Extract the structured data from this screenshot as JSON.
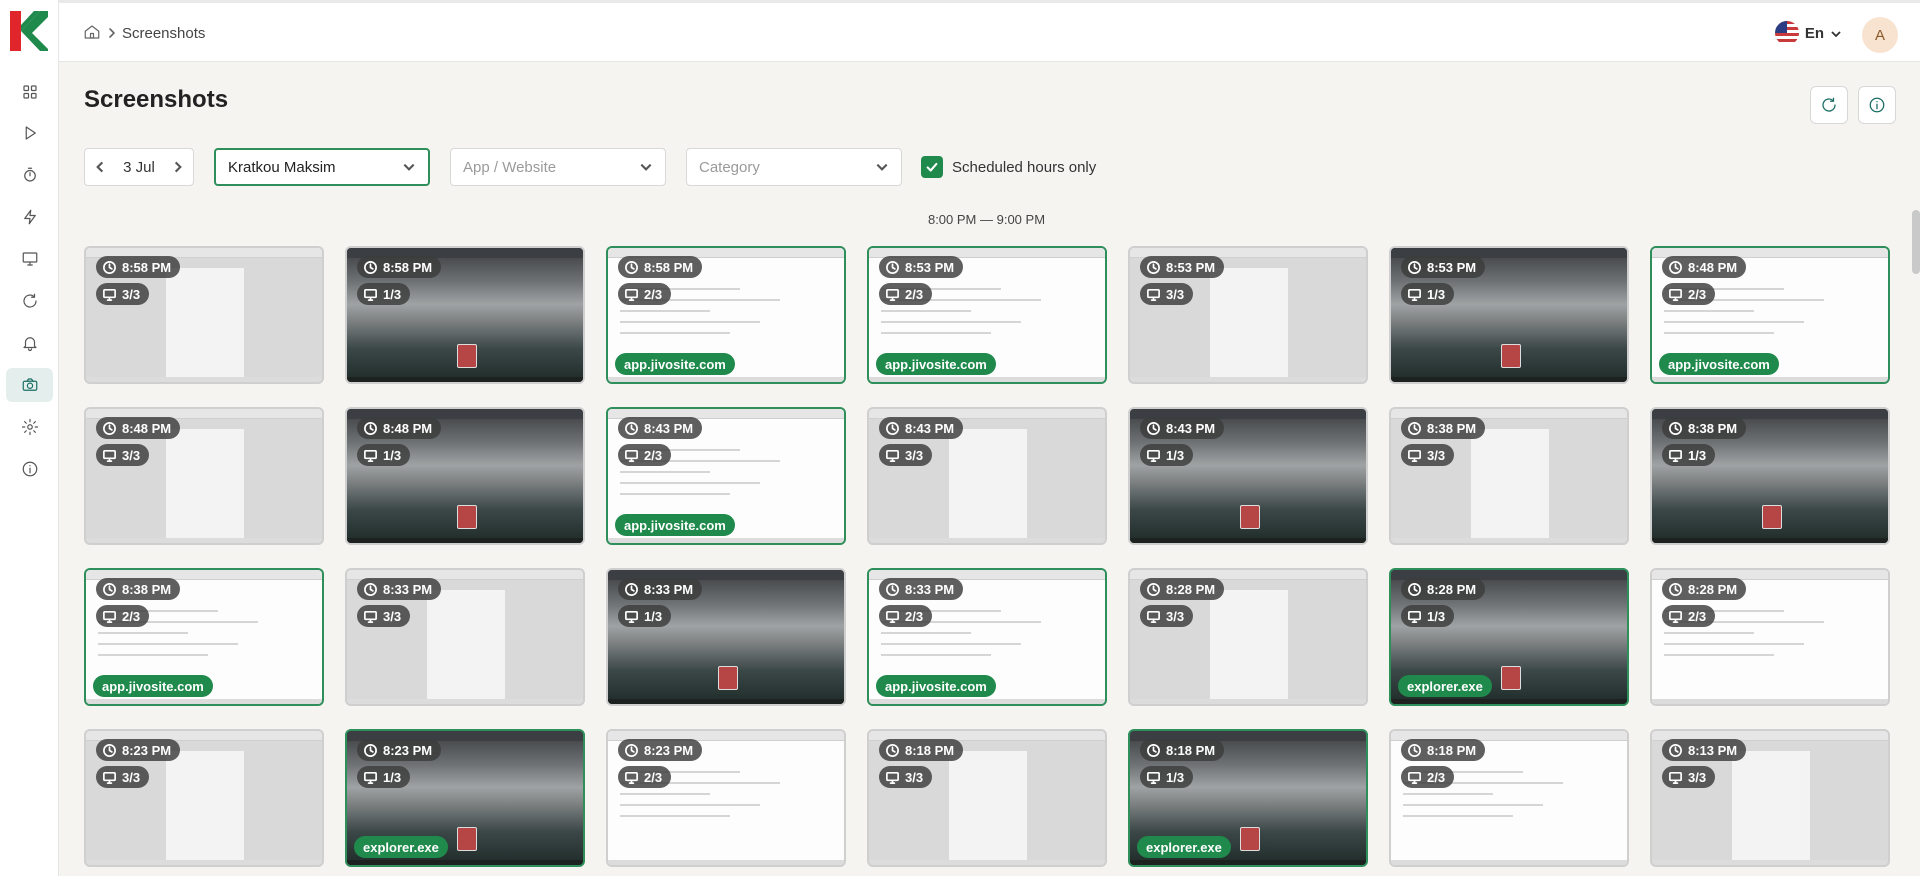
{
  "header": {
    "breadcrumb": "Screenshots",
    "language": "En",
    "avatar_initial": "A"
  },
  "page": {
    "title": "Screenshots"
  },
  "filters": {
    "date": "3 Jul",
    "employee": "Kratkou Maksim",
    "app_placeholder": "App / Website",
    "category_placeholder": "Category",
    "scheduled_label": "Scheduled hours only",
    "scheduled_checked": true
  },
  "time_range": "8:00 PM — 9:00 PM",
  "colors": {
    "accent": "#1f8a4c",
    "brand_green": "#2f8f5b",
    "logo_red": "#e0262b"
  },
  "screenshots": [
    {
      "time": "8:58 PM",
      "monitor": "3/3",
      "kind": "doc",
      "app": "",
      "highlight": false
    },
    {
      "time": "8:58 PM",
      "monitor": "1/3",
      "kind": "desk",
      "app": "",
      "highlight": false
    },
    {
      "time": "8:58 PM",
      "monitor": "2/3",
      "kind": "web",
      "app": "app.jivosite.com",
      "highlight": true
    },
    {
      "time": "8:53 PM",
      "monitor": "2/3",
      "kind": "web",
      "app": "app.jivosite.com",
      "highlight": true
    },
    {
      "time": "8:53 PM",
      "monitor": "3/3",
      "kind": "doc",
      "app": "",
      "highlight": false
    },
    {
      "time": "8:53 PM",
      "monitor": "1/3",
      "kind": "desk",
      "app": "",
      "highlight": false
    },
    {
      "time": "8:48 PM",
      "monitor": "2/3",
      "kind": "web",
      "app": "app.jivosite.com",
      "highlight": true
    },
    {
      "time": "8:48 PM",
      "monitor": "3/3",
      "kind": "doc",
      "app": "",
      "highlight": false
    },
    {
      "time": "8:48 PM",
      "monitor": "1/3",
      "kind": "desk",
      "app": "",
      "highlight": false
    },
    {
      "time": "8:43 PM",
      "monitor": "2/3",
      "kind": "web",
      "app": "app.jivosite.com",
      "highlight": true
    },
    {
      "time": "8:43 PM",
      "monitor": "3/3",
      "kind": "doc",
      "app": "",
      "highlight": false
    },
    {
      "time": "8:43 PM",
      "monitor": "1/3",
      "kind": "desk",
      "app": "",
      "highlight": false
    },
    {
      "time": "8:38 PM",
      "monitor": "3/3",
      "kind": "doc",
      "app": "",
      "highlight": false
    },
    {
      "time": "8:38 PM",
      "monitor": "1/3",
      "kind": "desk",
      "app": "",
      "highlight": false
    },
    {
      "time": "8:38 PM",
      "monitor": "2/3",
      "kind": "web",
      "app": "app.jivosite.com",
      "highlight": true
    },
    {
      "time": "8:33 PM",
      "monitor": "3/3",
      "kind": "doc",
      "app": "",
      "highlight": false
    },
    {
      "time": "8:33 PM",
      "monitor": "1/3",
      "kind": "desk",
      "app": "",
      "highlight": false
    },
    {
      "time": "8:33 PM",
      "monitor": "2/3",
      "kind": "web",
      "app": "app.jivosite.com",
      "highlight": true
    },
    {
      "time": "8:28 PM",
      "monitor": "3/3",
      "kind": "doc",
      "app": "",
      "highlight": false
    },
    {
      "time": "8:28 PM",
      "monitor": "1/3",
      "kind": "desk",
      "app": "explorer.exe",
      "highlight": true
    },
    {
      "time": "8:28 PM",
      "monitor": "2/3",
      "kind": "web",
      "app": "",
      "highlight": false
    },
    {
      "time": "8:23 PM",
      "monitor": "3/3",
      "kind": "doc",
      "app": "",
      "highlight": false
    },
    {
      "time": "8:23 PM",
      "monitor": "1/3",
      "kind": "desk",
      "app": "explorer.exe",
      "highlight": true
    },
    {
      "time": "8:23 PM",
      "monitor": "2/3",
      "kind": "web",
      "app": "",
      "highlight": false
    },
    {
      "time": "8:18 PM",
      "monitor": "3/3",
      "kind": "doc",
      "app": "",
      "highlight": false
    },
    {
      "time": "8:18 PM",
      "monitor": "1/3",
      "kind": "desk",
      "app": "explorer.exe",
      "highlight": true
    },
    {
      "time": "8:18 PM",
      "monitor": "2/3",
      "kind": "web",
      "app": "",
      "highlight": false
    },
    {
      "time": "8:13 PM",
      "monitor": "3/3",
      "kind": "doc",
      "app": "",
      "highlight": false
    }
  ]
}
